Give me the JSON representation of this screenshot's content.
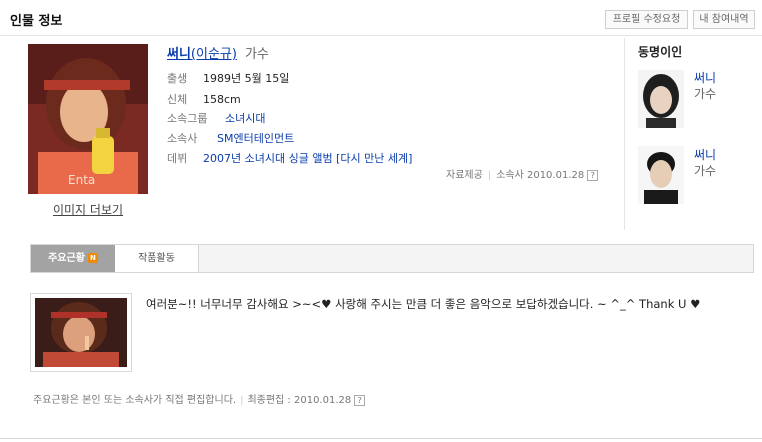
{
  "header": {
    "title": "인물 정보",
    "btn_edit": "프로필 수정요청",
    "btn_history": "내 참여내역"
  },
  "profile": {
    "more_images": "이미지 더보기",
    "name": "써니",
    "real_name": "(이순규)",
    "job": "가수",
    "birth_label": "출생",
    "birth": "1989년 5월 15일",
    "body_label": "신체",
    "body": "158cm",
    "group_label": "소속그룹",
    "group": "소녀시대",
    "agency_label": "소속사",
    "agency": "SM엔터테인먼트",
    "debut_label": "데뷔",
    "debut": "2007년 소녀시대 싱글 앨범 [다시 만난 세계]",
    "source_label": "자료제공",
    "source": "소속사 2010.01.28"
  },
  "same_name": {
    "title": "동명이인",
    "people": [
      {
        "name": "써니",
        "job": "가수"
      },
      {
        "name": "써니",
        "job": "가수"
      }
    ]
  },
  "tabs": {
    "main": "주요근황",
    "main_badge": "N",
    "works": "작품활동"
  },
  "post": {
    "text": "여러분~!! 너무너무 감사해요 >~<♥ 사랑해 주시는 만큼 더 좋은 음악으로 보답하겠습니다. ~ ^_^ Thank U ♥",
    "footer_note": "주요근황은 본인 또는 소속사가 직접 편집합니다.",
    "last_edit": "최종편집 : 2010.01.28"
  }
}
